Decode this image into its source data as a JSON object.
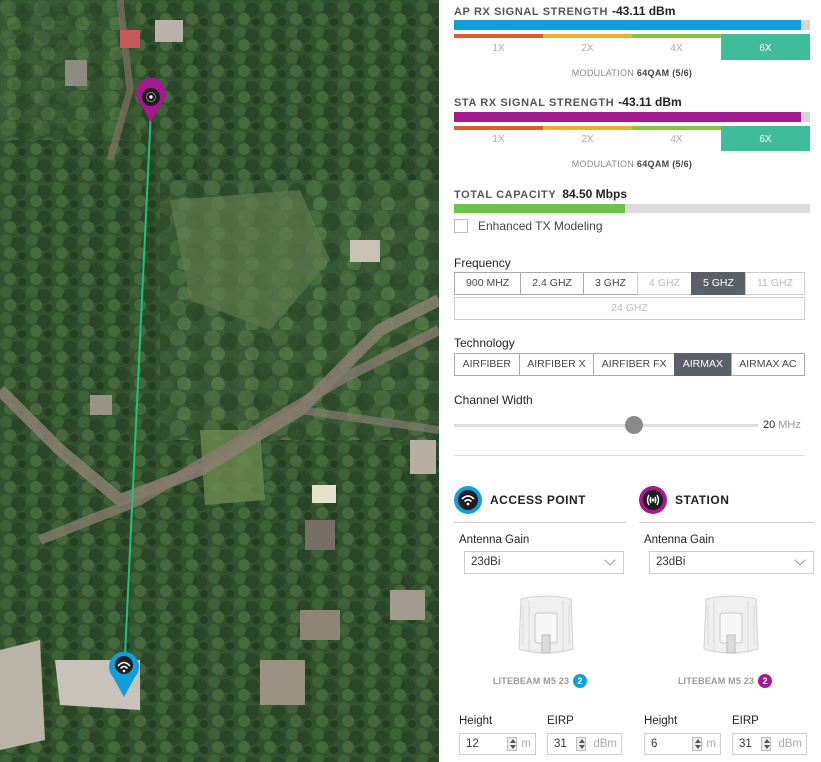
{
  "ap_rx": {
    "title": "AP RX SIGNAL STRENGTH",
    "value": "-43.11 dBm",
    "fill_fraction": 0.975,
    "mcs_labels": [
      "1X",
      "2X",
      "4X",
      "6X"
    ],
    "active_mcs": "6X",
    "modulation_label": "MODULATION",
    "modulation_value": "64QAM (5/6)",
    "color": "#0fa0dc"
  },
  "sta_rx": {
    "title": "STA RX SIGNAL STRENGTH",
    "value": "-43.11 dBm",
    "fill_fraction": 0.975,
    "mcs_labels": [
      "1X",
      "2X",
      "4X",
      "6X"
    ],
    "active_mcs": "6X",
    "modulation_label": "MODULATION",
    "modulation_value": "64QAM (5/6)",
    "color": "#a3198f"
  },
  "mcs_colors": [
    "#e05a2a",
    "#e7b12b",
    "#8ac43f",
    "#3fbd9a"
  ],
  "capacity": {
    "title": "TOTAL CAPACITY",
    "value": "84.50 Mbps",
    "fill_fraction": 0.48
  },
  "enhanced_tx": {
    "label": "Enhanced TX Modeling",
    "checked": false
  },
  "frequency": {
    "label": "Frequency",
    "options": [
      "900 MHZ",
      "2.4 GHZ",
      "3 GHZ",
      "4 GHZ",
      "5 GHZ",
      "11 GHZ"
    ],
    "selected": "5 GHZ",
    "disabled": [
      "4 GHZ",
      "11 GHZ"
    ],
    "extra_option": "24 GHZ"
  },
  "technology": {
    "label": "Technology",
    "options": [
      "AIRFIBER",
      "AIRFIBER X",
      "AIRFIBER FX",
      "AIRMAX",
      "AIRMAX AC"
    ],
    "selected": "AIRMAX"
  },
  "channel_width": {
    "label": "Channel Width",
    "value": "20",
    "unit": "MHz"
  },
  "access_point": {
    "title": "ACCESS POINT",
    "gain_label": "Antenna Gain",
    "gain_value": "23dBi",
    "model": "LITEBEAM M5 23",
    "count": "2",
    "height_label": "Height",
    "height_value": "12",
    "height_unit": "m",
    "eirp_label": "EIRP",
    "eirp_value": "31",
    "eirp_unit": "dBm",
    "color": "#0fa0dc"
  },
  "station": {
    "title": "STATION",
    "gain_label": "Antenna Gain",
    "gain_value": "23dBi",
    "model": "LITEBEAM M5 23",
    "count": "2",
    "height_label": "Height",
    "height_value": "6",
    "height_unit": "m",
    "eirp_label": "EIRP",
    "eirp_value": "31",
    "eirp_unit": "dBm",
    "color": "#a3198f"
  },
  "link_color": "#22c07a"
}
